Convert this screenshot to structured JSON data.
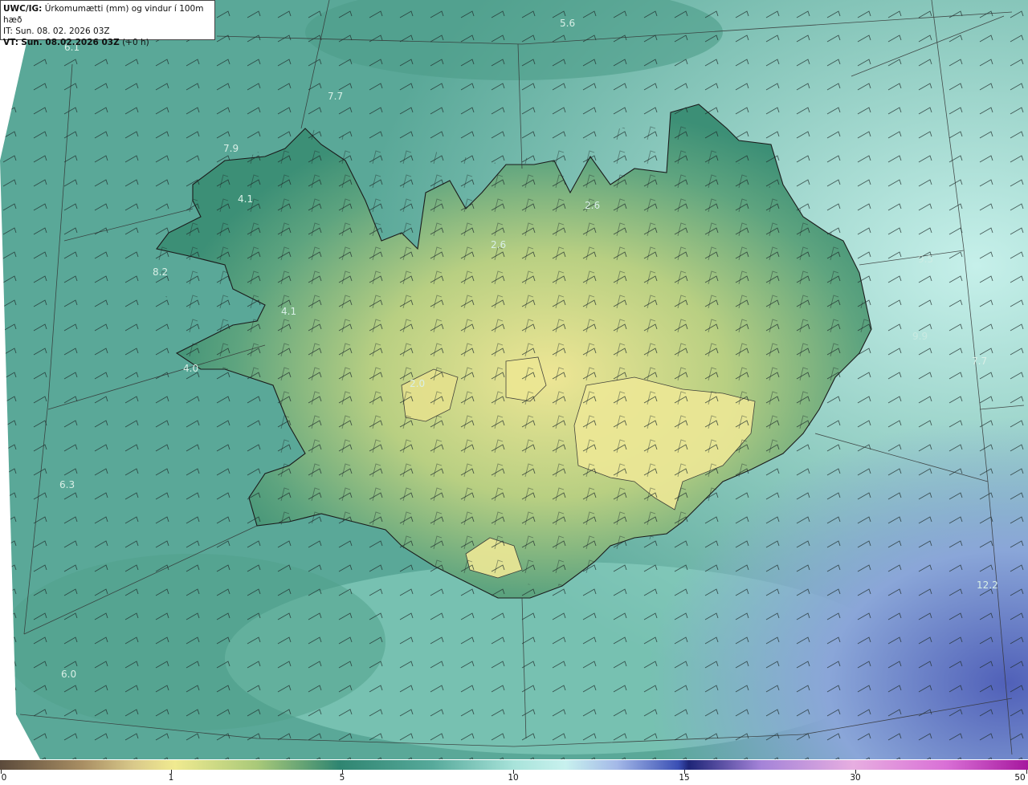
{
  "header": {
    "model": "UWC/IG:",
    "title": "Úrkomumætti (mm) og vindur í 100m hæð",
    "it_label": "IT:",
    "it_value": "Sun. 08. 02. 2026 03Z",
    "vt_label": "VT:",
    "vt_value": "Sun. 08.02.2026 03Z",
    "vt_offset": "(+0 h)"
  },
  "value_labels": [
    {
      "id": "v1",
      "text": "5.6"
    },
    {
      "id": "v2",
      "text": "6.1"
    },
    {
      "id": "v3",
      "text": "7.7"
    },
    {
      "id": "v4",
      "text": "7.9"
    },
    {
      "id": "v5",
      "text": "4.1"
    },
    {
      "id": "v6",
      "text": "8.2"
    },
    {
      "id": "v7",
      "text": "4.1"
    },
    {
      "id": "v8",
      "text": "4.0"
    },
    {
      "id": "v9",
      "text": "2.6"
    },
    {
      "id": "v10",
      "text": "2.6"
    },
    {
      "id": "v11",
      "text": "2.0"
    },
    {
      "id": "v12",
      "text": "6.3"
    },
    {
      "id": "v13",
      "text": "6.0"
    },
    {
      "id": "v14",
      "text": "12.2"
    },
    {
      "id": "v15",
      "text": "7.7"
    },
    {
      "id": "v16",
      "text": "9.5"
    },
    {
      "id": "v17",
      "text": "9.9"
    }
  ],
  "colorbar": {
    "ticks": [
      "0",
      "1",
      "5",
      "10",
      "15",
      "30",
      "50"
    ],
    "colors": {
      "low": "#5b4a3b",
      "mid": "#2f8571",
      "high": "#a6179e"
    }
  },
  "colors": {
    "sea": "#5aa898",
    "land_low": "#2e7f6b",
    "land_high": "#e7e58e",
    "ocean_light": "#c8f1ee"
  }
}
